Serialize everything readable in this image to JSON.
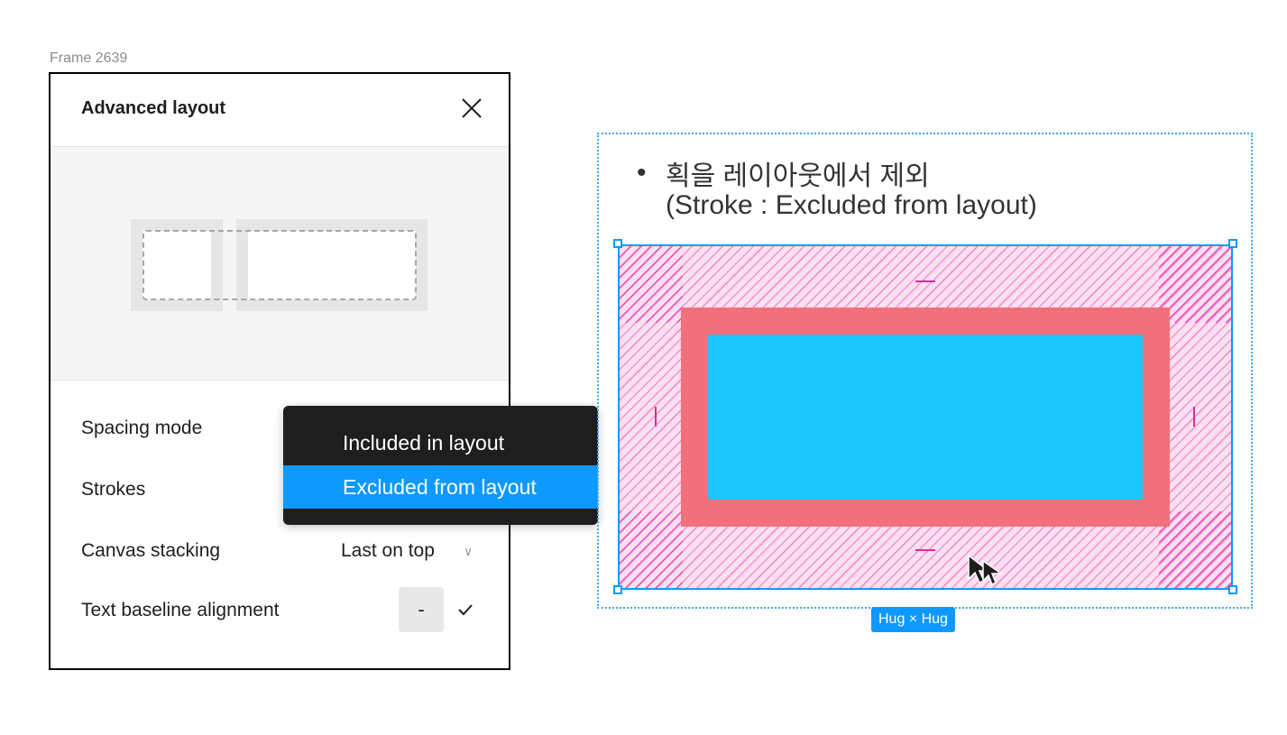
{
  "frame_label": "Frame 2639",
  "panel": {
    "title": "Advanced layout",
    "rows": {
      "spacing_mode": "Spacing mode",
      "strokes": "Strokes",
      "canvas_stacking": "Canvas stacking",
      "canvas_stacking_value": "Last on top",
      "text_baseline": "Text baseline alignment",
      "text_baseline_value": "-"
    }
  },
  "dropdown": {
    "options": [
      "Included in layout",
      "Excluded from layout"
    ],
    "selected": "Excluded from layout"
  },
  "canvas": {
    "note_bullet": "•",
    "note_line1": "획을 레이아웃에서 제외",
    "note_line2": "(Stroke : Excluded from layout)",
    "size_badge": "Hug × Hug"
  },
  "colors": {
    "selection": "#0d99ff",
    "stroke": "#f2707b",
    "fill": "#1fc8fc",
    "padding_hatch": "#f24eba",
    "menu_bg": "#1e1e1e"
  }
}
